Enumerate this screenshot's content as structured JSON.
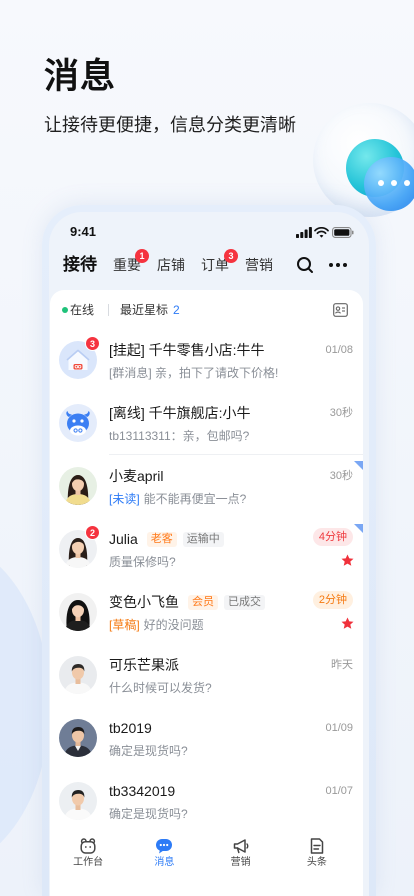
{
  "promo": {
    "title": "消息",
    "subtitle": "让接待更便捷，信息分类更清晰"
  },
  "status_bar": {
    "time": "9:41",
    "icons": [
      "signal-icon",
      "wifi-icon",
      "battery-icon"
    ]
  },
  "tabs": [
    {
      "label": "接待",
      "active": true
    },
    {
      "label": "重要",
      "badge": "1"
    },
    {
      "label": "店铺"
    },
    {
      "label": "订单",
      "badge": "3"
    },
    {
      "label": "营销"
    }
  ],
  "header_actions": [
    "search-icon",
    "more-icon"
  ],
  "subheader": {
    "status": "在线",
    "starred_label": "最近星标",
    "starred_count": "2",
    "icon": "contact-card-icon"
  },
  "conversations": [
    {
      "title": "[挂起] 千牛零售小店:牛牛",
      "time": "01/08",
      "preview": "[群消息] 亲，拍下了请改下价格!",
      "badge": "3",
      "avatar": "store-icon"
    },
    {
      "title": "[离线] 千牛旗舰店:小牛",
      "time": "30秒",
      "preview": "tb13113311：亲，包邮吗?",
      "avatar": "cow-mascot-icon"
    },
    {
      "title": "小麦april",
      "time": "30秒",
      "preview_tag": "[未读]",
      "preview": "能不能再便宜一点?",
      "corner_mark": true
    },
    {
      "title": "Julia",
      "tags": [
        "老客",
        "运输中"
      ],
      "time": "4分钟",
      "preview": "质量保修吗?",
      "badge": "2",
      "starred": true,
      "corner_mark": true
    },
    {
      "title": "变色小飞鱼",
      "tags": [
        "会员",
        "已成交"
      ],
      "time": "2分钟",
      "preview_tag": "[草稿]",
      "preview": "好的没问题",
      "starred": true
    },
    {
      "title": "可乐芒果派",
      "time": "昨天",
      "preview": "什么时候可以发货?"
    },
    {
      "title": "tb2019",
      "time": "01/09",
      "preview": "确定是现货吗?"
    },
    {
      "title": "tb3342019",
      "time": "01/07",
      "preview": "确定是现货吗?"
    }
  ],
  "bottom_nav": [
    {
      "label": "工作台",
      "icon": "bear-icon"
    },
    {
      "label": "消息",
      "icon": "chat-icon",
      "active": true
    },
    {
      "label": "营销",
      "icon": "megaphone-icon"
    },
    {
      "label": "头条",
      "icon": "document-icon"
    }
  ],
  "colors": {
    "accent": "#2d7bf6",
    "badge_red": "#f5333f",
    "online_green": "#1fc27a",
    "tag_orange": "#ff7a1a",
    "star_red": "#f0313b"
  }
}
